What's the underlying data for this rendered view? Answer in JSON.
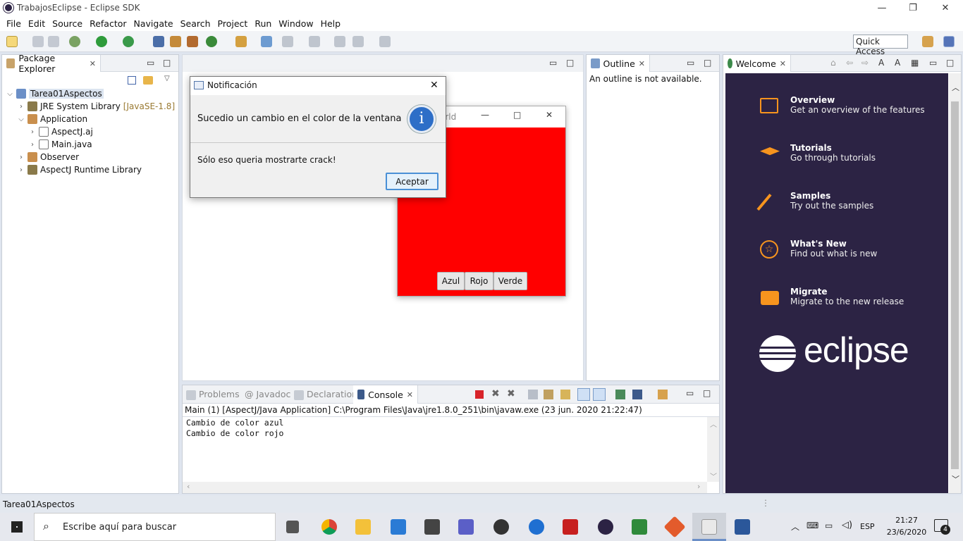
{
  "window": {
    "title": "TrabajosEclipse - Eclipse SDK",
    "min": "—",
    "restore": "❐",
    "close": "✕"
  },
  "menu": [
    "File",
    "Edit",
    "Source",
    "Refactor",
    "Navigate",
    "Search",
    "Project",
    "Run",
    "Window",
    "Help"
  ],
  "quick_access": "Quick Access",
  "package_explorer": {
    "tab_label": "Package Explorer",
    "tree": [
      {
        "label": "Tarea01Aspectos",
        "suffix": ""
      },
      {
        "label": "JRE System Library",
        "suffix": "[JavaSE-1.8]"
      },
      {
        "label": "Application",
        "suffix": ""
      },
      {
        "label": "AspectJ.aj",
        "suffix": ""
      },
      {
        "label": "Main.java",
        "suffix": ""
      },
      {
        "label": "Observer",
        "suffix": ""
      },
      {
        "label": "AspectJ Runtime Library",
        "suffix": ""
      }
    ]
  },
  "outline": {
    "tab_label": "Outline",
    "message": "An outline is not available."
  },
  "welcome": {
    "tab_label": "Welcome",
    "items": [
      {
        "title": "Overview",
        "desc": "Get an overview of the features"
      },
      {
        "title": "Tutorials",
        "desc": "Go through tutorials"
      },
      {
        "title": "Samples",
        "desc": "Try out the samples"
      },
      {
        "title": "What's New",
        "desc": "Find out what is new"
      },
      {
        "title": "Migrate",
        "desc": "Migrate to the new release"
      }
    ],
    "logo_text": "eclipse"
  },
  "app_window": {
    "title_fragment": "orld",
    "buttons": [
      "Azul",
      "Rojo",
      "Verde"
    ],
    "bg_color": "#ff0000"
  },
  "dialog": {
    "title": "Notificación",
    "header": "Sucedio un cambio en el color de la ventana",
    "icon_letter": "i",
    "content": "Sólo eso queria mostrarte crack!",
    "ok": "Aceptar"
  },
  "console": {
    "tabs": [
      "Problems",
      "Javadoc",
      "Declaration",
      "Console"
    ],
    "description": "Main (1) [AspectJ/Java Application] C:\\Program Files\\Java\\jre1.8.0_251\\bin\\javaw.exe (23 jun. 2020 21:22:47)",
    "lines": [
      "Cambio de color azul",
      "Cambio de color rojo"
    ]
  },
  "status_text": "Tarea01Aspectos",
  "taskbar": {
    "search_placeholder": "Escribe aquí para buscar",
    "language": "ESP",
    "time": "21:27",
    "date": "23/6/2020",
    "notifications": "4"
  }
}
